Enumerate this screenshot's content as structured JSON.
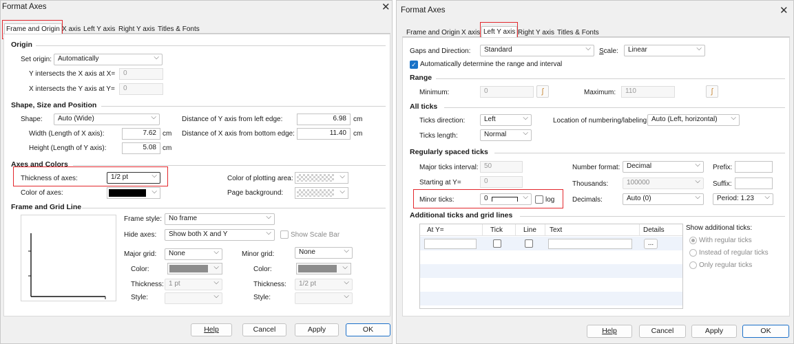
{
  "left": {
    "title": "Format Axes",
    "tabs": [
      "Frame and Origin",
      "X axis",
      "Left Y axis",
      "Right Y axis",
      "Titles & Fonts"
    ],
    "origin": {
      "heading": "Origin",
      "set_origin_label": "Set origin:",
      "set_origin_value": "Automatically",
      "y_intersect_label": "Y intersects the X axis at X=",
      "y_intersect_value": "0",
      "x_intersect_label": "X intersects the Y axis at Y=",
      "x_intersect_value": "0"
    },
    "shape": {
      "heading": "Shape, Size and Position",
      "shape_label": "Shape:",
      "shape_value": "Auto (Wide)",
      "width_label": "Width (Length of X axis):",
      "width_value": "7.62",
      "width_unit": "cm",
      "height_label": "Height (Length of Y axis):",
      "height_value": "5.08",
      "height_unit": "cm",
      "dist_left_label": "Distance of Y axis from left edge:",
      "dist_left_value": "6.98",
      "dist_left_unit": "cm",
      "dist_bottom_label": "Distance of X axis from bottom edge:",
      "dist_bottom_value": "11.40",
      "dist_bottom_unit": "cm"
    },
    "colors": {
      "heading": "Axes and Colors",
      "thickness_label": "Thickness of axes:",
      "thickness_value": "1/2 pt",
      "color_label": "Color of axes:",
      "plot_area_label": "Color of plotting area:",
      "page_bg_label": "Page background:"
    },
    "frame": {
      "heading": "Frame and Grid Line",
      "frame_style_label": "Frame style:",
      "frame_style_value": "No frame",
      "hide_axes_label": "Hide axes:",
      "hide_axes_value": "Show both X and Y",
      "show_scale_bar": "Show Scale Bar",
      "major_grid_label": "Major grid:",
      "major_grid_value": "None",
      "minor_grid_label": "Minor grid:",
      "minor_grid_value": "None",
      "color_label": "Color:",
      "thickness_label": "Thickness:",
      "major_thickness_value": "1 pt",
      "minor_thickness_value": "1/2 pt",
      "style_label": "Style:"
    },
    "buttons": {
      "help": "Help",
      "cancel": "Cancel",
      "apply": "Apply",
      "ok": "OK"
    }
  },
  "right": {
    "title": "Format Axes",
    "tabs": [
      "Frame and Origin",
      "X axis",
      "Left Y axis",
      "Right Y axis",
      "Titles & Fonts"
    ],
    "gaps_label": "Gaps and Direction:",
    "gaps_value": "Standard",
    "scale_label": "Scale:",
    "scale_value": "Linear",
    "auto_range_label": "Automatically determine the range and interval",
    "range": {
      "heading": "Range",
      "min_label": "Minimum:",
      "min_value": "0",
      "max_label": "Maximum:",
      "max_value": "110"
    },
    "ticks": {
      "heading": "All ticks",
      "direction_label": "Ticks direction:",
      "direction_value": "Left",
      "length_label": "Ticks length:",
      "length_value": "Normal",
      "location_label": "Location of numbering/labeling:",
      "location_value": "Auto (Left, horizontal)"
    },
    "regular": {
      "heading": "Regularly spaced ticks",
      "major_label": "Major ticks interval:",
      "major_value": "50",
      "start_label": "Starting at Y=",
      "start_value": "0",
      "minor_label": "Minor ticks:",
      "minor_value": "0",
      "log_label": "log",
      "numfmt_label": "Number format:",
      "numfmt_value": "Decimal",
      "thousands_label": "Thousands:",
      "thousands_value": "100000",
      "decimals_label": "Decimals:",
      "decimals_value": "Auto (0)",
      "prefix_label": "Prefix:",
      "suffix_label": "Suffix:",
      "period_value": "Period: 1.23"
    },
    "additional": {
      "heading": "Additional ticks and grid lines",
      "columns": [
        "At Y=",
        "Tick",
        "Line",
        "Text",
        "Details"
      ],
      "details_btn": "...",
      "show_label": "Show additional ticks:",
      "options": [
        "With regular ticks",
        "Instead of regular ticks",
        "Only regular ticks"
      ]
    },
    "buttons": {
      "help": "Help",
      "cancel": "Cancel",
      "apply": "Apply",
      "ok": "OK"
    }
  }
}
